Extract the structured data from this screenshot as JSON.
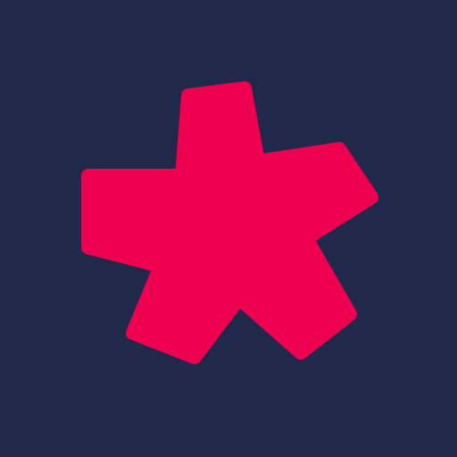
{
  "icon": {
    "name": "asterisk-logo",
    "background_color": "#20294a",
    "mark_color": "#ee0051",
    "arm_count": 5
  }
}
